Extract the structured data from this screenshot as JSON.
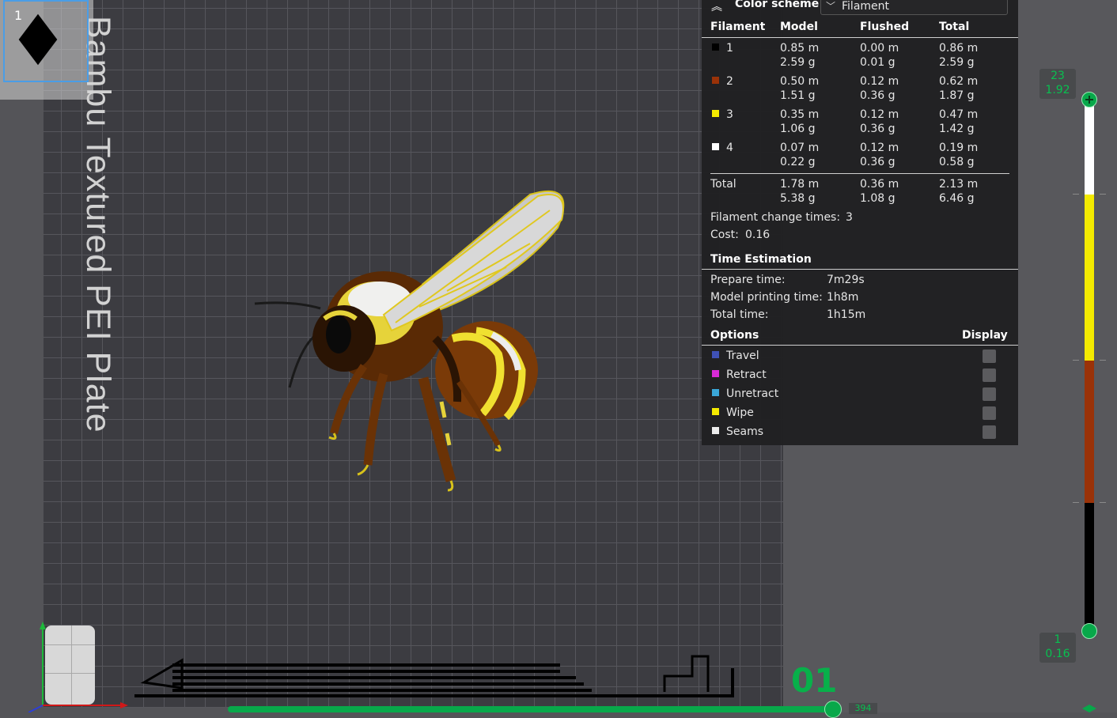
{
  "plate": {
    "number": "1",
    "label": "Bambu Textured PEI Plate"
  },
  "panel": {
    "color_scheme_label": "Color scheme",
    "scheme_value": "Filament",
    "headers": {
      "filament": "Filament",
      "model": "Model",
      "flushed": "Flushed",
      "total": "Total"
    },
    "rows": [
      {
        "id": "1",
        "color": "#000000",
        "model_m": "0.85 m",
        "model_g": "2.59 g",
        "flushed_m": "0.00 m",
        "flushed_g": "0.01 g",
        "total_m": "0.86 m",
        "total_g": "2.59 g"
      },
      {
        "id": "2",
        "color": "#9a3208",
        "model_m": "0.50 m",
        "model_g": "1.51 g",
        "flushed_m": "0.12 m",
        "flushed_g": "0.36 g",
        "total_m": "0.62 m",
        "total_g": "1.87 g"
      },
      {
        "id": "3",
        "color": "#f4ea00",
        "model_m": "0.35 m",
        "model_g": "1.06 g",
        "flushed_m": "0.12 m",
        "flushed_g": "0.36 g",
        "total_m": "0.47 m",
        "total_g": "1.42 g"
      },
      {
        "id": "4",
        "color": "#ffffff",
        "model_m": "0.07 m",
        "model_g": "0.22 g",
        "flushed_m": "0.12 m",
        "flushed_g": "0.36 g",
        "total_m": "0.19 m",
        "total_g": "0.58 g"
      }
    ],
    "total_row": {
      "label": "Total",
      "model_m": "1.78 m",
      "model_g": "5.38 g",
      "flushed_m": "0.36 m",
      "flushed_g": "1.08 g",
      "total_m": "2.13 m",
      "total_g": "6.46 g"
    },
    "filament_change": {
      "label": "Filament change times:",
      "value": "3"
    },
    "cost": {
      "label": "Cost:",
      "value": "0.16"
    },
    "time": {
      "title": "Time Estimation",
      "prepare_label": "Prepare time:",
      "prepare_value": "7m29s",
      "model_label": "Model printing time:",
      "model_value": "1h8m",
      "total_label": "Total time:",
      "total_value": "1h15m"
    },
    "options": {
      "title": "Options",
      "display_label": "Display",
      "items": [
        {
          "label": "Travel",
          "color": "#3f51b5"
        },
        {
          "label": "Retract",
          "color": "#d82ad6"
        },
        {
          "label": "Unretract",
          "color": "#3aa7d8"
        },
        {
          "label": "Wipe",
          "color": "#f4ea00"
        },
        {
          "label": "Seams",
          "color": "#ececec"
        }
      ]
    }
  },
  "layer_slider": {
    "top_layer": "23",
    "top_height": "1.92",
    "bottom_layer": "1",
    "bottom_height": "0.16",
    "segments": [
      "#ffffff",
      "#f4ea00",
      "#9a3208",
      "#000000"
    ]
  },
  "move_slider": {
    "current": "01",
    "value": "394"
  },
  "accent": "#08a84a"
}
